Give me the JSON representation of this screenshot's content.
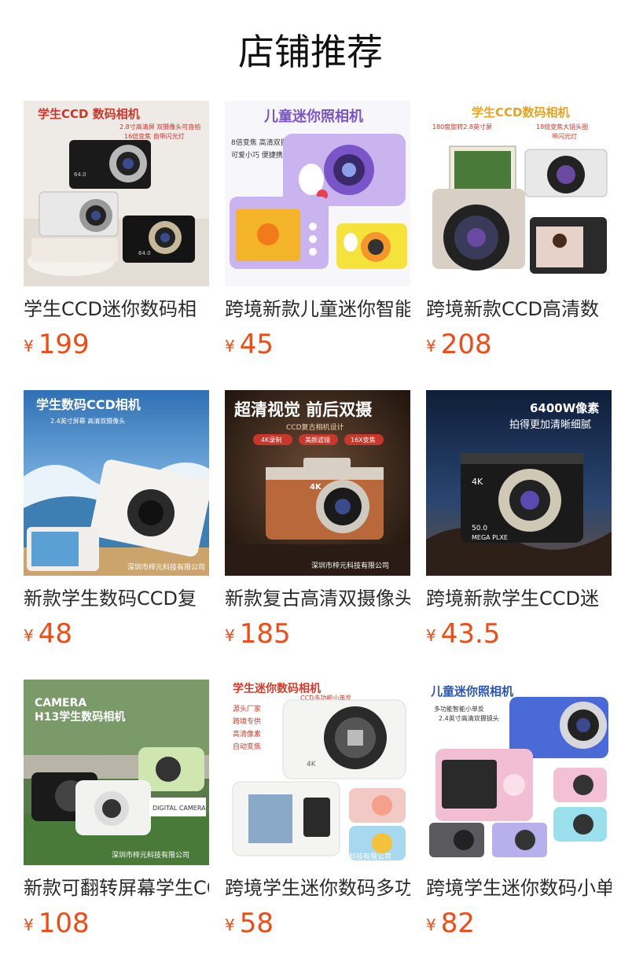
{
  "header": {
    "title": "店铺推荐"
  },
  "products": [
    {
      "title": "学生CCD迷你数码相",
      "currency": "¥",
      "price": "199",
      "image": {
        "headline": "学生CCD 数码相机",
        "lines": [
          "2.8寸高清屏 双摄像头可自拍",
          "16倍变焦 自带闪光灯"
        ],
        "badges": [],
        "watermark": "",
        "bg": "#eeeae6",
        "accent": "#c9372c"
      }
    },
    {
      "title": "跨境新款儿童迷你智能",
      "currency": "¥",
      "price": "45",
      "image": {
        "headline": "儿童迷你照相机",
        "lines": [
          "8倍变焦 高清双摄",
          "可爱小巧 便捷携带"
        ],
        "badges": [],
        "watermark": "",
        "bg": "#f7f6fb",
        "accent": "#7a55c7"
      }
    },
    {
      "title": "跨境新款CCD高清数",
      "currency": "¥",
      "price": "208",
      "image": {
        "headline": "学生CCD数码相机",
        "lines": [
          "180度旋转2.8英寸屏",
          "18倍变焦大镜头圈",
          "带闪光灯"
        ],
        "badges": [],
        "watermark": "",
        "bg": "#ffffff",
        "accent": "#e5a323"
      }
    },
    {
      "title": "新款学生数码CCD复",
      "currency": "¥",
      "price": "48",
      "image": {
        "headline": "学生数码CCD相机",
        "lines": [
          "2.4英寸屏幕 高清双摄像头"
        ],
        "badges": [],
        "watermark": "深圳市梓元科技有限公司",
        "bg": "#3a79b8",
        "accent": "#ffffff"
      }
    },
    {
      "title": "新款复古高清双摄像头",
      "currency": "¥",
      "price": "185",
      "image": {
        "headline": "超清视觉 前后双摄",
        "lines": [
          "CCD复古相机设计"
        ],
        "badges": [
          "4K录制",
          "美颜滤镜",
          "16X变焦"
        ],
        "watermark": "深圳市梓元科技有限公司",
        "bg": "#2a1a12",
        "accent": "#c8372c"
      }
    },
    {
      "title": "跨境新款学生CCD迷",
      "currency": "¥",
      "price": "43.5",
      "image": {
        "headline": "6400W像素",
        "lines": [
          "拍得更加清晰细腻"
        ],
        "badges": [],
        "watermark": "",
        "bg": "#1b2a4a",
        "accent": "#ffffff"
      }
    },
    {
      "title": "新款可翻转屏幕学生CCD",
      "currency": "¥",
      "price": "108",
      "image": {
        "headline": "CAMERA",
        "lines": [
          "H13学生数码相机"
        ],
        "badges": [],
        "watermark": "深圳市梓元科技有限公司",
        "bg": "#5a7a4a",
        "accent": "#ffffff"
      }
    },
    {
      "title": "跨境学生迷你数码多功能",
      "currency": "¥",
      "price": "58",
      "image": {
        "headline": "学生迷你数码相机",
        "lines": [
          "CCD多功能小单反"
        ],
        "side_lines": [
          "源头厂家",
          "跨境专供",
          "高清像素",
          "自动变焦"
        ],
        "badges": [],
        "watermark": "科技有限公司",
        "bg": "#ffffff",
        "accent": "#d23a2a"
      }
    },
    {
      "title": "跨境学生迷你数码小单反",
      "currency": "¥",
      "price": "82",
      "image": {
        "headline": "儿童迷你照相机",
        "lines": [
          "多功能智能小单反",
          "2.4英寸高清双摄镜头"
        ],
        "badges": [],
        "watermark": "",
        "bg": "#ffffff",
        "accent": "#2a56b8"
      }
    }
  ]
}
